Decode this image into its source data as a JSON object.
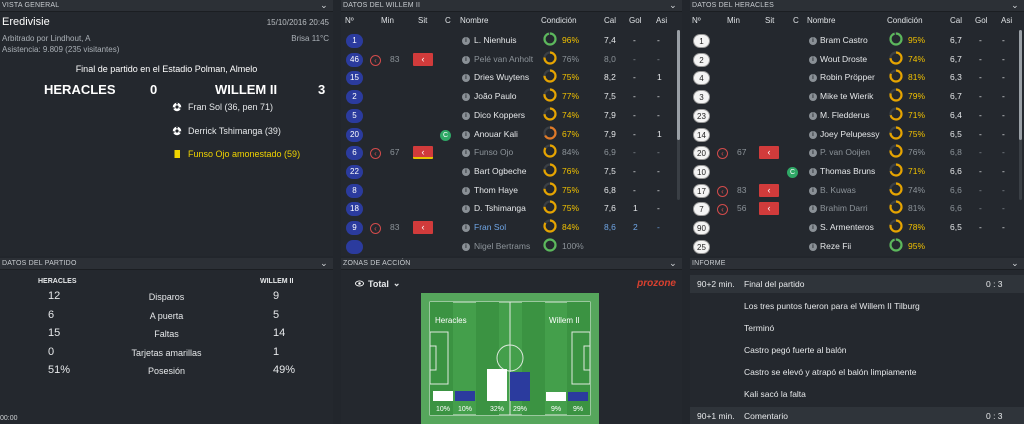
{
  "overview": {
    "header": "VISTA GENERAL",
    "league": "Eredivisie",
    "datetime": "15/10/2016 20:45",
    "referee": "Arbitrado por Lindhout, A",
    "weather": "Brisa 11°C",
    "attendance": "Asistencia: 9.809 (235 visitantes)",
    "final_text": "Final de partido en el Estadio Polman, Almelo",
    "home_team": "HERACLES",
    "home_score": "0",
    "away_team": "WILLEM II",
    "away_score": "3",
    "events": [
      {
        "icon": "goal-ball-icon",
        "text": "Fran Sol (36, pen 71)"
      },
      {
        "icon": "goal-ball-icon",
        "text": "Derrick Tshimanga (39)"
      },
      {
        "icon": "yellow-card-icon",
        "text": "Funso Ojo amonestado (59)"
      }
    ]
  },
  "columns": {
    "num": "Nº",
    "min": "Min",
    "sit": "Sit",
    "c": "C",
    "name": "Nombre",
    "cond": "Condición",
    "cal": "Cal",
    "gol": "Gol",
    "asi": "Asi"
  },
  "willem": {
    "header": "DATOS DEL WILLEM II",
    "players": [
      {
        "num": "1",
        "min": "",
        "sub": false,
        "cap": false,
        "name": "L. Nienhuis",
        "cond": "96%",
        "cond_v": 0.96,
        "cal": "7,4",
        "gol": "-",
        "asi": "-",
        "style": ""
      },
      {
        "num": "46",
        "min": "83",
        "sub": true,
        "cap": false,
        "name": "Pelé van Anholt",
        "cond": "76%",
        "cond_v": 0.76,
        "cal": "8,0",
        "gol": "-",
        "asi": "-",
        "style": "dim"
      },
      {
        "num": "15",
        "min": "",
        "sub": false,
        "cap": false,
        "name": "Dries Wuytens",
        "cond": "75%",
        "cond_v": 0.75,
        "cal": "8,2",
        "gol": "-",
        "asi": "1",
        "style": ""
      },
      {
        "num": "2",
        "min": "",
        "sub": false,
        "cap": false,
        "name": "João Paulo",
        "cond": "77%",
        "cond_v": 0.77,
        "cal": "7,5",
        "gol": "-",
        "asi": "-",
        "style": ""
      },
      {
        "num": "5",
        "min": "",
        "sub": false,
        "cap": false,
        "name": "Dico Koppers",
        "cond": "74%",
        "cond_v": 0.74,
        "cal": "7,9",
        "gol": "-",
        "asi": "-",
        "style": ""
      },
      {
        "num": "20",
        "min": "",
        "sub": false,
        "cap": true,
        "name": "Anouar Kali",
        "cond": "67%",
        "cond_v": 0.67,
        "cal": "7,9",
        "gol": "-",
        "asi": "1",
        "style": ""
      },
      {
        "num": "6",
        "min": "67",
        "sub": true,
        "cap": false,
        "name": "Funso Ojo",
        "cond": "84%",
        "cond_v": 0.84,
        "cal": "6,9",
        "gol": "-",
        "asi": "-",
        "style": "dim",
        "yellow": true
      },
      {
        "num": "22",
        "min": "",
        "sub": false,
        "cap": false,
        "name": "Bart Ogbeche",
        "cond": "76%",
        "cond_v": 0.76,
        "cal": "7,5",
        "gol": "-",
        "asi": "-",
        "style": ""
      },
      {
        "num": "8",
        "min": "",
        "sub": false,
        "cap": false,
        "name": "Thom Haye",
        "cond": "75%",
        "cond_v": 0.75,
        "cal": "6,8",
        "gol": "-",
        "asi": "-",
        "style": ""
      },
      {
        "num": "18",
        "min": "",
        "sub": false,
        "cap": false,
        "name": "D. Tshimanga",
        "cond": "75%",
        "cond_v": 0.75,
        "cal": "7,6",
        "gol": "1",
        "asi": "-",
        "style": ""
      },
      {
        "num": "9",
        "min": "83",
        "sub": true,
        "cap": false,
        "name": "Fran Sol",
        "cond": "84%",
        "cond_v": 0.84,
        "cal": "8,6",
        "gol": "2",
        "asi": "-",
        "style": "hl"
      },
      {
        "num": "",
        "min": "",
        "sub": false,
        "cap": false,
        "name": "Nigel Bertrams",
        "cond": "100%",
        "cond_v": 1.0,
        "cal": "",
        "gol": "",
        "asi": "",
        "style": "dim"
      }
    ]
  },
  "heracles": {
    "header": "DATOS DEL HERACLES",
    "players": [
      {
        "num": "1",
        "min": "",
        "sub": false,
        "cap": false,
        "name": "Bram Castro",
        "cond": "95%",
        "cond_v": 0.95,
        "cal": "6,7",
        "gol": "-",
        "asi": "-",
        "style": ""
      },
      {
        "num": "2",
        "min": "",
        "sub": false,
        "cap": false,
        "name": "Wout Droste",
        "cond": "74%",
        "cond_v": 0.74,
        "cal": "6,7",
        "gol": "-",
        "asi": "-",
        "style": ""
      },
      {
        "num": "4",
        "min": "",
        "sub": false,
        "cap": false,
        "name": "Robin Pröpper",
        "cond": "81%",
        "cond_v": 0.81,
        "cal": "6,3",
        "gol": "-",
        "asi": "-",
        "style": ""
      },
      {
        "num": "3",
        "min": "",
        "sub": false,
        "cap": false,
        "name": "Mike te Wierik",
        "cond": "79%",
        "cond_v": 0.79,
        "cal": "6,7",
        "gol": "-",
        "asi": "-",
        "style": ""
      },
      {
        "num": "23",
        "min": "",
        "sub": false,
        "cap": false,
        "name": "M. Fledderus",
        "cond": "71%",
        "cond_v": 0.71,
        "cal": "6,4",
        "gol": "-",
        "asi": "-",
        "style": ""
      },
      {
        "num": "14",
        "min": "",
        "sub": false,
        "cap": false,
        "name": "Joey Pelupessy",
        "cond": "75%",
        "cond_v": 0.75,
        "cal": "6,5",
        "gol": "-",
        "asi": "-",
        "style": ""
      },
      {
        "num": "20",
        "min": "67",
        "sub": true,
        "cap": false,
        "name": "P. van Ooijen",
        "cond": "76%",
        "cond_v": 0.76,
        "cal": "6,8",
        "gol": "-",
        "asi": "-",
        "style": "dim"
      },
      {
        "num": "10",
        "min": "",
        "sub": false,
        "cap": true,
        "name": "Thomas Bruns",
        "cond": "71%",
        "cond_v": 0.71,
        "cal": "6,6",
        "gol": "-",
        "asi": "-",
        "style": ""
      },
      {
        "num": "17",
        "min": "83",
        "sub": true,
        "cap": false,
        "name": "B. Kuwas",
        "cond": "74%",
        "cond_v": 0.74,
        "cal": "6,6",
        "gol": "-",
        "asi": "-",
        "style": "dim"
      },
      {
        "num": "7",
        "min": "56",
        "sub": true,
        "cap": false,
        "name": "Brahim Darri",
        "cond": "81%",
        "cond_v": 0.81,
        "cal": "6,6",
        "gol": "-",
        "asi": "-",
        "style": "dim"
      },
      {
        "num": "90",
        "min": "",
        "sub": false,
        "cap": false,
        "name": "S. Armenteros",
        "cond": "78%",
        "cond_v": 0.78,
        "cal": "6,5",
        "gol": "-",
        "asi": "-",
        "style": ""
      },
      {
        "num": "25",
        "min": "",
        "sub": false,
        "cap": false,
        "name": "Reze Fii",
        "cond": "95%",
        "cond_v": 0.95,
        "cal": "",
        "gol": "",
        "asi": "",
        "style": ""
      }
    ]
  },
  "stats": {
    "header": "DATOS DEL PARTIDO",
    "home": "HERACLES",
    "away": "WILLEM II",
    "rows": [
      {
        "label": "Disparos",
        "home": "12",
        "away": "9"
      },
      {
        "label": "A puerta",
        "home": "6",
        "away": "5"
      },
      {
        "label": "Faltas",
        "home": "15",
        "away": "14"
      },
      {
        "label": "Tarjetas amarillas",
        "home": "0",
        "away": "1"
      },
      {
        "label": "Posesión",
        "home": "51%",
        "away": "49%"
      }
    ],
    "corner_time": "00:00"
  },
  "zones": {
    "header": "ZONAS DE ACCIÓN",
    "filter": "Total",
    "brand": "prozone",
    "home": "Heracles",
    "away": "Willem II",
    "bars": [
      {
        "home": 10,
        "away": 10,
        "home_label": "10%",
        "away_label": "10%"
      },
      {
        "home": 32,
        "away": 29,
        "home_label": "32%",
        "away_label": "29%"
      },
      {
        "home": 9,
        "away": 9,
        "home_label": "9%",
        "away_label": "9%"
      }
    ]
  },
  "report": {
    "header": "INFORME",
    "rows": [
      {
        "time": "90+2 min.",
        "text": "Final del partido",
        "score": "0 : 3",
        "band": true
      },
      {
        "time": "",
        "text": "Los tres puntos fueron para el Willem II Tilburg",
        "score": "",
        "band": false
      },
      {
        "time": "",
        "text": "Terminó",
        "score": "",
        "band": false
      },
      {
        "time": "",
        "text": "Castro pegó fuerte al balón",
        "score": "",
        "band": false
      },
      {
        "time": "",
        "text": "Castro se elevó y atrapó el balón limpiamente",
        "score": "",
        "band": false
      },
      {
        "time": "",
        "text": "Kali sacó la falta",
        "score": "",
        "band": false
      },
      {
        "time": "90+1 min.",
        "text": "Comentario",
        "score": "0 : 3",
        "band": true
      }
    ]
  },
  "colors": {
    "home_blue": "#2b3b9e",
    "sub_red": "#d13b3b",
    "cond_yellow": "#e6a400",
    "cond_green": "#5cb85c",
    "cond_orange": "#e07a28",
    "pitch_green": "#3f9a46"
  }
}
